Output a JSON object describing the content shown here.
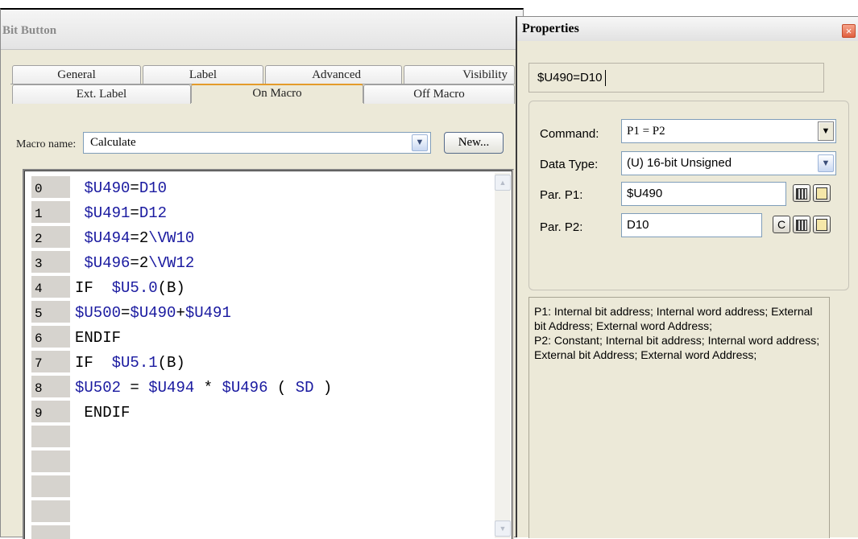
{
  "bit_button": {
    "title": "Bit Button",
    "tabs_row1": [
      "General",
      "Label",
      "Advanced",
      "Visibility"
    ],
    "tabs_row2": [
      "Ext. Label",
      "On Macro",
      "Off Macro"
    ],
    "active_tab": "On Macro",
    "macro_name_label": "Macro name:",
    "macro_name_value": "Calculate",
    "new_button_label": "New...",
    "lines": [
      {
        "num": "0",
        "text": " $U490=D10"
      },
      {
        "num": "1",
        "text": " $U491=D12"
      },
      {
        "num": "2",
        "text": " $U494=2\\VW10"
      },
      {
        "num": "3",
        "text": " $U496=2\\VW12"
      },
      {
        "num": "4",
        "text": "IF  $U5.0(B)"
      },
      {
        "num": "5",
        "text": "$U500=$U490+$U491"
      },
      {
        "num": "6",
        "text": "ENDIF"
      },
      {
        "num": "7",
        "text": "IF  $U5.1(B)"
      },
      {
        "num": "8",
        "text": "$U502 = $U494 * $U496 ( SD )"
      },
      {
        "num": "9",
        "text": " ENDIF"
      },
      {
        "num": "",
        "text": ""
      },
      {
        "num": "",
        "text": ""
      },
      {
        "num": "",
        "text": ""
      },
      {
        "num": "",
        "text": ""
      },
      {
        "num": "",
        "text": ""
      }
    ]
  },
  "properties": {
    "title": "Properties",
    "close_glyph": "×",
    "expression": "$U490=D10",
    "command_label": "Command:",
    "command_value": "P1 = P2",
    "data_type_label": "Data Type:",
    "data_type_value": "(U) 16-bit Unsigned",
    "p1_label": "Par. P1:",
    "p1_value": "$U490",
    "p2_label": "Par. P2:",
    "p2_value": "D10",
    "constant_button": "C",
    "description_p1": "P1: Internal bit address; Internal word address; External bit Address; External word Address;",
    "description_p2": "P2: Constant; Internal bit address; Internal word address; External bit Address; External word Address;"
  },
  "icons": {
    "dropdown": "▼",
    "scroll_up": "▲",
    "scroll_down": "▼"
  },
  "colors": {
    "active_tab_accent": "#e49b2a",
    "address_text": "#1a1aa0",
    "close_button": "#e0603f"
  }
}
